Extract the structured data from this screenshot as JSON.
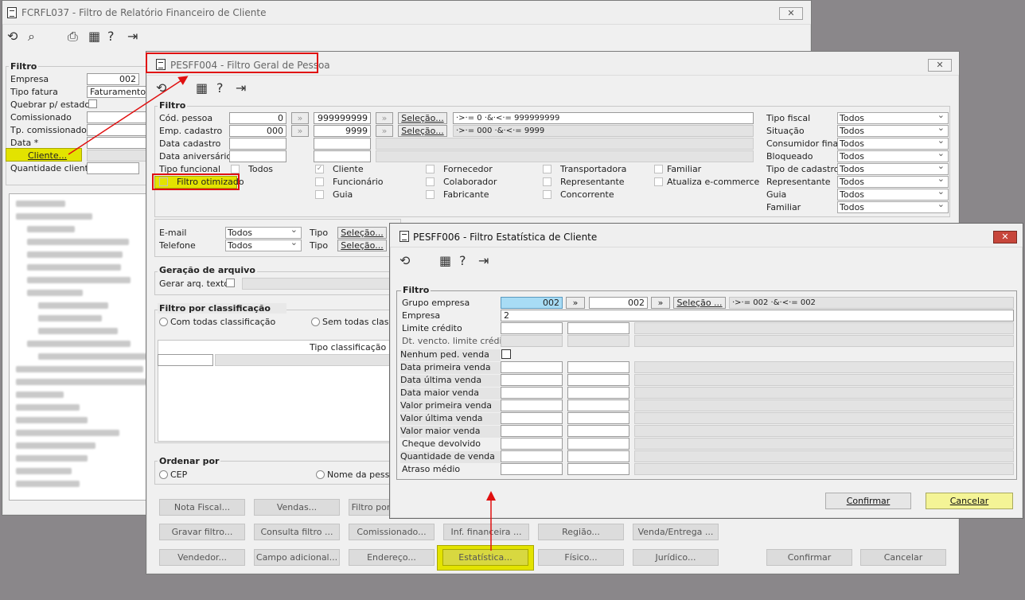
{
  "win1": {
    "title": "FCRFL037 - Filtro de Relatório Financeiro de Cliente",
    "close": "✕",
    "section_filtro": "Filtro",
    "labels": [
      "Empresa",
      "Tipo fatura",
      "Quebrar p/ estado",
      "Comissionado",
      "Tp. comissionado",
      "Data *",
      "Quantidade cliente"
    ],
    "empresa_value": "002",
    "tipo_fatura_value": "Faturamento",
    "cliente_button": "Cliente..."
  },
  "win2": {
    "title": "PESFF004 - Filtro Geral de Pessoa",
    "close": "✕",
    "section_filtro": "Filtro",
    "left_labels": [
      "Cód. pessoa",
      "Emp. cadastro",
      "Data cadastro",
      "Data aniversário",
      "Tipo funcional"
    ],
    "cod_from": "0",
    "cod_to": "999999999",
    "emp_from": "000",
    "emp_to": "9999",
    "cod_expr": "·>·= 0 ·&·<·= 999999999",
    "emp_expr": "·>·= 000 ·&·<·= 9999",
    "selecao": "Seleção...",
    "todos_chk": "Todos",
    "filtro_otimizado": "Filtro otimizado",
    "types_col1": [
      "Cliente",
      "Funcionário",
      "Guia"
    ],
    "types_col2": [
      "Fornecedor",
      "Colaborador",
      "Fabricante"
    ],
    "types_col3": [
      "Transportadora",
      "Representante",
      "Concorrente"
    ],
    "types_col4": [
      "Familiar",
      "Atualiza e-commerce"
    ],
    "right_labels": [
      "Tipo fiscal",
      "Situação",
      "Consumidor final",
      "Bloqueado",
      "Tipo de cadastro",
      "Representante",
      "Guia",
      "Familiar"
    ],
    "right_values": [
      "Todos",
      "Todos",
      "Todos",
      "Todos",
      "Todos",
      "Todos",
      "Todos",
      "Todos"
    ],
    "email_label": "E-mail",
    "telefone_label": "Telefone",
    "email_value": "Todos",
    "telefone_value": "Todos",
    "tipo_label": "Tipo",
    "geracao_title": "Geração de arquivo",
    "gerar_label": "Gerar arq. texto",
    "classif_title": "Filtro por classificação",
    "com_todas": "Com todas classificação",
    "sem_todas": "Sem todas classi",
    "tipo_classif": "Tipo classificação",
    "ordenar_title": "Ordenar por",
    "cep": "CEP",
    "nome_pessoa": "Nome da pesso",
    "buttons_row1": [
      "Nota Fiscal...",
      "Vendas...",
      "Filtro por"
    ],
    "buttons_row2": [
      "Gravar filtro...",
      "Consulta filtro ...",
      "Comissionado...",
      "Inf. financeira ...",
      "Região...",
      "Venda/Entrega ..."
    ],
    "buttons_row3": [
      "Vendedor...",
      "Campo adicional...",
      "Endereço...",
      "Estatística...",
      "Físico...",
      "Jurídico..."
    ],
    "confirmar": "Confirmar",
    "cancelar": "Cancelar"
  },
  "win3": {
    "title": "PESFF006 - Filtro Estatística de Cliente",
    "close": "✕",
    "section_filtro": "Filtro",
    "labels": [
      "Grupo empresa",
      "Empresa",
      "Limite crédito",
      "Dt. vencto. limite crédito",
      "Nenhum ped. venda",
      "Data primeira venda",
      "Data última venda",
      "Data maior venda",
      "Valor primeira venda",
      "Valor última venda",
      "Valor maior venda",
      "Cheque devolvido",
      "Quantidade de venda",
      "Atraso médio"
    ],
    "grupo_from": "002",
    "grupo_to": "002",
    "grupo_expr": "·>·= 002 ·&·<·= 002",
    "empresa_value": "2",
    "selecao": "Seleção ...",
    "dbl_arrow": "»",
    "confirmar": "Confirmar",
    "cancelar": "Cancelar"
  },
  "colors": {
    "highlight": "#e3e300",
    "annotation": "#e01010",
    "input_active": "#a8dcf5"
  },
  "icons": [
    "document-icon",
    "refresh-icon",
    "search-icon",
    "print-icon",
    "calendar-icon",
    "help-icon",
    "exit-icon",
    "close-icon",
    "double-arrow-icon"
  ]
}
